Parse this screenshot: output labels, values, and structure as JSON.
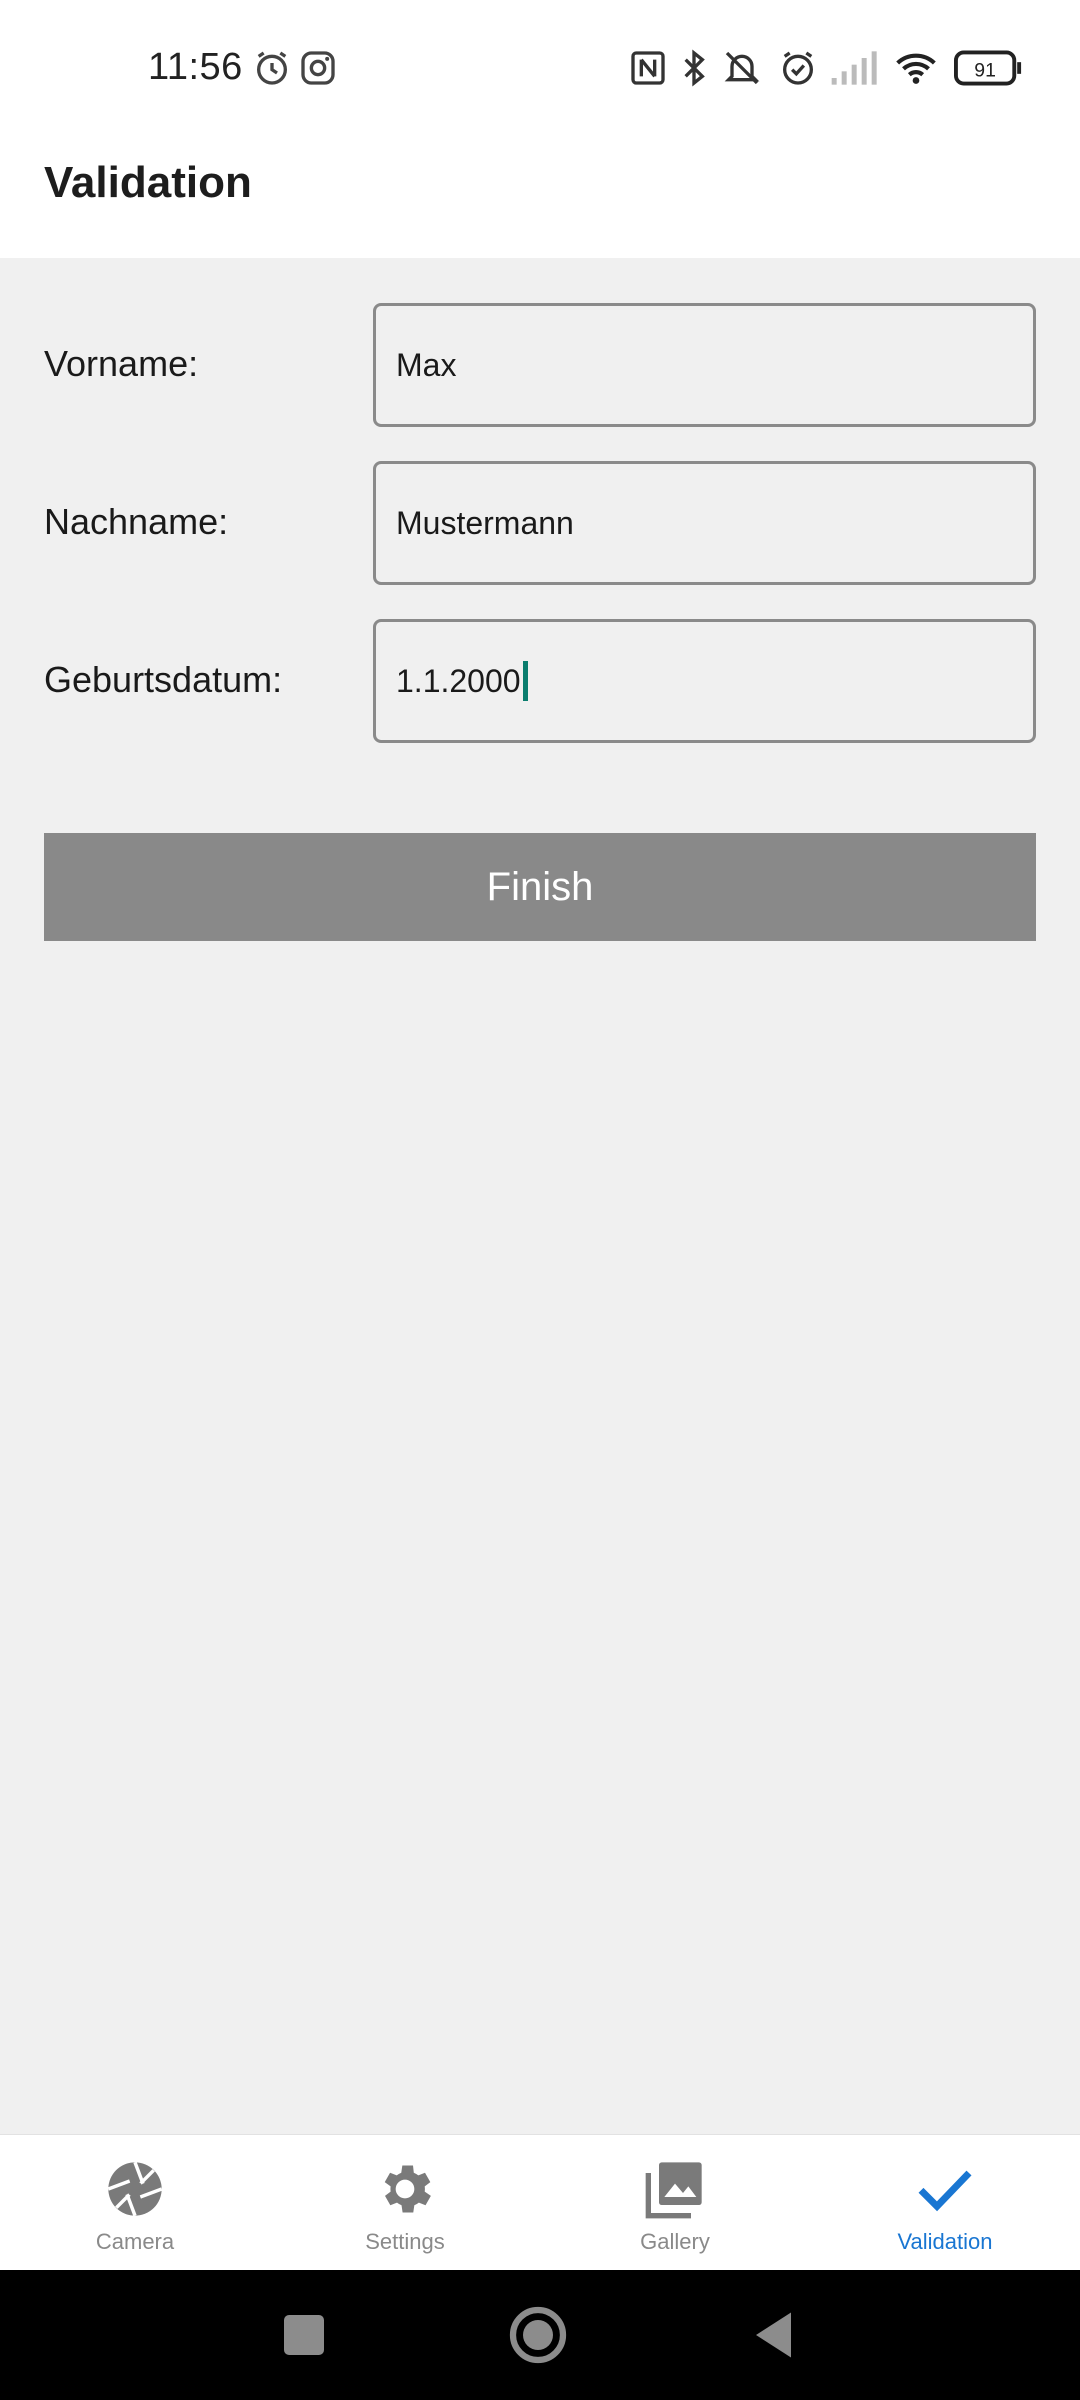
{
  "status_bar": {
    "time": "11:56",
    "battery": "91"
  },
  "app_bar": {
    "title": "Validation"
  },
  "form": {
    "fields": [
      {
        "label": "Vorname:",
        "value": "Max"
      },
      {
        "label": "Nachname:",
        "value": "Mustermann"
      },
      {
        "label": "Geburtsdatum:",
        "value": "1.1.2000"
      }
    ],
    "finish_label": "Finish"
  },
  "bottom_nav": {
    "items": [
      {
        "label": "Camera",
        "icon": "camera-aperture-icon"
      },
      {
        "label": "Settings",
        "icon": "gear-icon"
      },
      {
        "label": "Gallery",
        "icon": "gallery-icon"
      },
      {
        "label": "Validation",
        "icon": "checkmark-icon"
      }
    ],
    "active_index": 3
  },
  "colors": {
    "accent": "#1976d2",
    "button": "#898989",
    "caret": "#0a7d6e",
    "background": "#f0f0f0"
  }
}
